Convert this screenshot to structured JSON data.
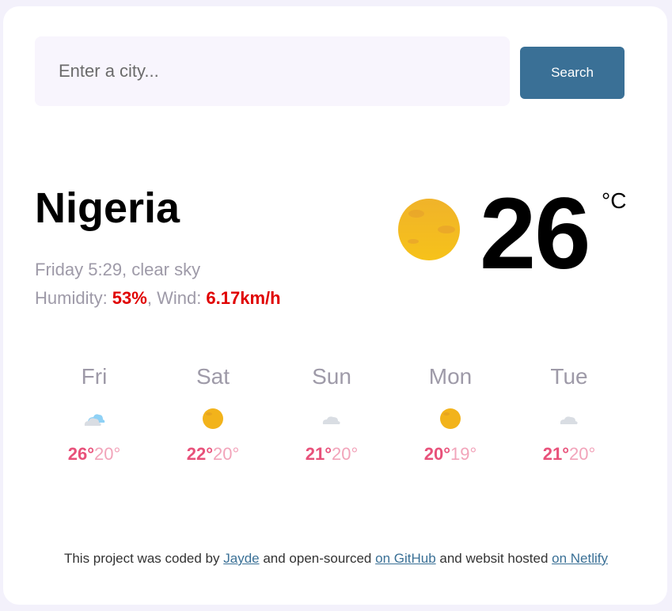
{
  "search": {
    "placeholder": "Enter a city...",
    "value": "",
    "button_label": "Search"
  },
  "current": {
    "city": "Nigeria",
    "day_time_desc": "Friday 5:29, clear sky",
    "humidity_label": "Humidity: ",
    "humidity_value": "53%",
    "wind_label": ", Wind: ",
    "wind_value": "6.17km/h",
    "temperature": "26",
    "unit": "°C",
    "icon": "sun-icon"
  },
  "forecast": [
    {
      "day": "Fri",
      "max": "26°",
      "min": "20°",
      "icon": "sun-behind-cloud-icon"
    },
    {
      "day": "Sat",
      "max": "22°",
      "min": "20°",
      "icon": "sun-icon"
    },
    {
      "day": "Sun",
      "max": "21°",
      "min": "20°",
      "icon": "cloud-icon"
    },
    {
      "day": "Mon",
      "max": "20°",
      "min": "19°",
      "icon": "sun-icon"
    },
    {
      "day": "Tue",
      "max": "21°",
      "min": "20°",
      "icon": "cloud-icon"
    }
  ],
  "footer": {
    "text_1": "This project was coded by ",
    "link_1": "Jayde",
    "text_2": " and open-sourced ",
    "link_2": "on GitHub",
    "text_3": " and websit hosted ",
    "link_3": "on Netlify"
  },
  "colors": {
    "accent": "#3a7096",
    "highlight": "#e00000",
    "temp_max": "#e8517a",
    "temp_min": "#f2a4ba"
  }
}
